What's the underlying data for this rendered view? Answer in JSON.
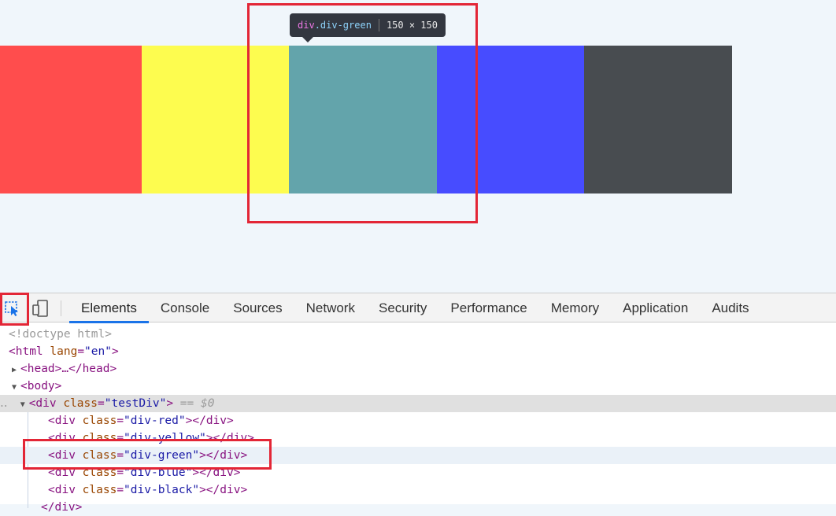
{
  "colors": {
    "page_bg": "#f0f6fb",
    "red": "#ff4d4d",
    "yellow": "#fdfc4f",
    "green": "#63a4ab",
    "blue": "#474cff",
    "black": "#484c50",
    "annotation": "#e32636"
  },
  "tooltip": {
    "tag": "div",
    "class": ".div-green",
    "size": "150 × 150"
  },
  "toolbar": {
    "icons": [
      "inspect-element-icon",
      "device-toolbar-icon"
    ],
    "tabs": [
      {
        "label": "Elements",
        "active": true
      },
      {
        "label": "Console"
      },
      {
        "label": "Sources"
      },
      {
        "label": "Network"
      },
      {
        "label": "Security"
      },
      {
        "label": "Performance"
      },
      {
        "label": "Memory"
      },
      {
        "label": "Application"
      },
      {
        "label": "Audits"
      }
    ]
  },
  "dom": {
    "doctype": "<!doctype html>",
    "html_open": "<html",
    "html_attr": "lang",
    "html_val": "\"en\"",
    "head": "<head>…</head>",
    "body": "<body>",
    "testdiv_class": "\"testDiv\"",
    "eq0": "== $0",
    "children": [
      {
        "class": "\"div-red\""
      },
      {
        "class": "\"div-yellow\""
      },
      {
        "class": "\"div-green\""
      },
      {
        "class": "\"div-blue\""
      },
      {
        "class": "\"div-black\""
      }
    ],
    "div_open": "<div",
    "class_attr": "class",
    "div_close": "></div>",
    "close_div": "</div>"
  }
}
